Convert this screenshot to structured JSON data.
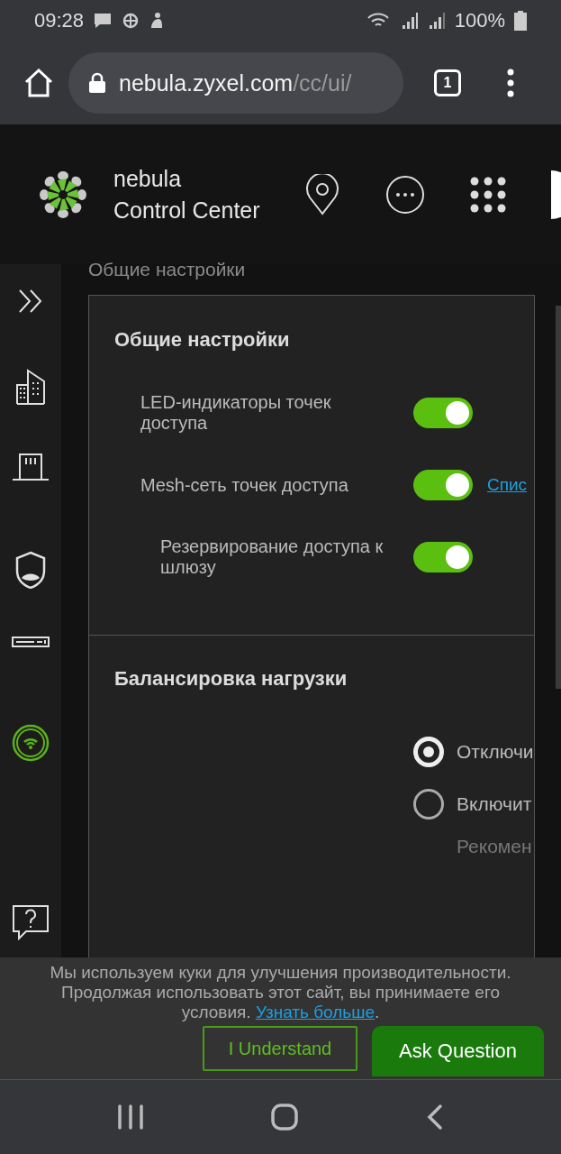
{
  "status_bar": {
    "time": "09:28",
    "battery": "100%"
  },
  "browser": {
    "url_host": "nebula.zyxel.com",
    "url_path": "/cc/ui/",
    "tab_count": "1"
  },
  "header": {
    "brand_line1": "nebula",
    "brand_line2": "Control Center"
  },
  "sidebar": {
    "items": [
      {
        "kind": "expand",
        "selected": false
      },
      {
        "kind": "site",
        "selected": false
      },
      {
        "kind": "gateway",
        "selected": false
      },
      {
        "kind": "security",
        "selected": false
      },
      {
        "kind": "switch",
        "selected": false
      },
      {
        "kind": "wifi",
        "selected": true
      },
      {
        "kind": "help",
        "selected": false
      }
    ]
  },
  "breadcrumb": "Общие настройки",
  "sections": [
    {
      "kind": "toggles",
      "title": "Общие настройки",
      "rows": [
        {
          "label": "LED-индикаторы точек доступа",
          "on": true
        },
        {
          "label": "Mesh-сеть точек доступа",
          "on": true,
          "link": "Спис",
          "children": [
            {
              "label": "Резервирование доступа к шлюзу",
              "on": true
            }
          ]
        }
      ]
    },
    {
      "kind": "radios",
      "title": "Балансировка нагрузки",
      "options": [
        {
          "label": "Отключи",
          "selected": true
        },
        {
          "label": "Включит",
          "selected": false
        }
      ],
      "note": "Рекомен"
    }
  ],
  "cookie_banner": {
    "text": "Мы используем куки для улучшения производительности. Продолжая использовать этот сайт, вы принимаете его условия. ",
    "link": "Узнать больше",
    "tail": ".",
    "buttons": [
      {
        "kind": "outline",
        "label": "I Understand"
      },
      {
        "kind": "filled",
        "label": "Ask Question"
      }
    ]
  }
}
